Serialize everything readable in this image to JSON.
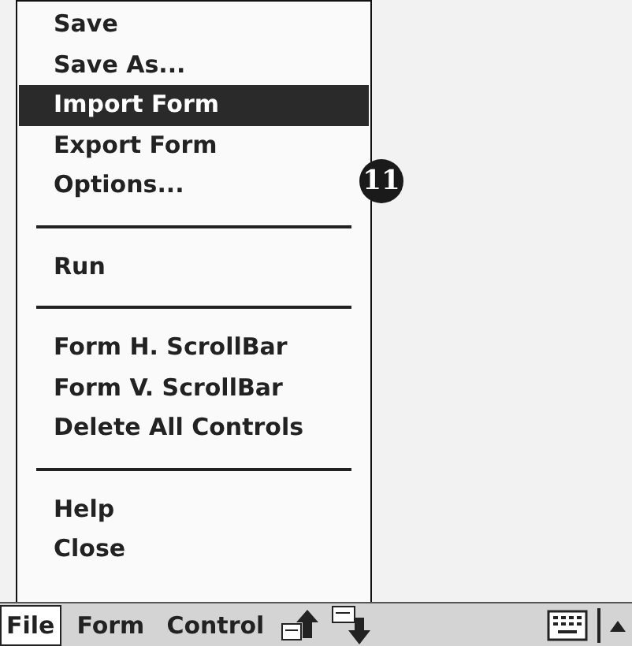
{
  "menu": {
    "items": [
      {
        "kind": "item",
        "label": "Save",
        "selected": false
      },
      {
        "kind": "item",
        "label": "Save As...",
        "selected": false
      },
      {
        "kind": "item",
        "label": "Import Form",
        "selected": true
      },
      {
        "kind": "item",
        "label": "Export Form",
        "selected": false
      },
      {
        "kind": "item",
        "label": "Options...",
        "selected": false
      },
      {
        "kind": "separator"
      },
      {
        "kind": "item",
        "label": "Run",
        "selected": false
      },
      {
        "kind": "separator"
      },
      {
        "kind": "item",
        "label": "Form H. ScrollBar",
        "selected": false
      },
      {
        "kind": "item",
        "label": "Form V. ScrollBar",
        "selected": false
      },
      {
        "kind": "item",
        "label": "Delete All Controls",
        "selected": false
      },
      {
        "kind": "separator"
      },
      {
        "kind": "item",
        "label": "Help",
        "selected": false
      },
      {
        "kind": "item",
        "label": "Close",
        "selected": false
      }
    ]
  },
  "callout": {
    "label": "11"
  },
  "menu_bar": {
    "menus": [
      {
        "label": "File",
        "selected": true
      },
      {
        "label": "Form",
        "selected": false
      },
      {
        "label": "Control",
        "selected": false
      }
    ]
  }
}
